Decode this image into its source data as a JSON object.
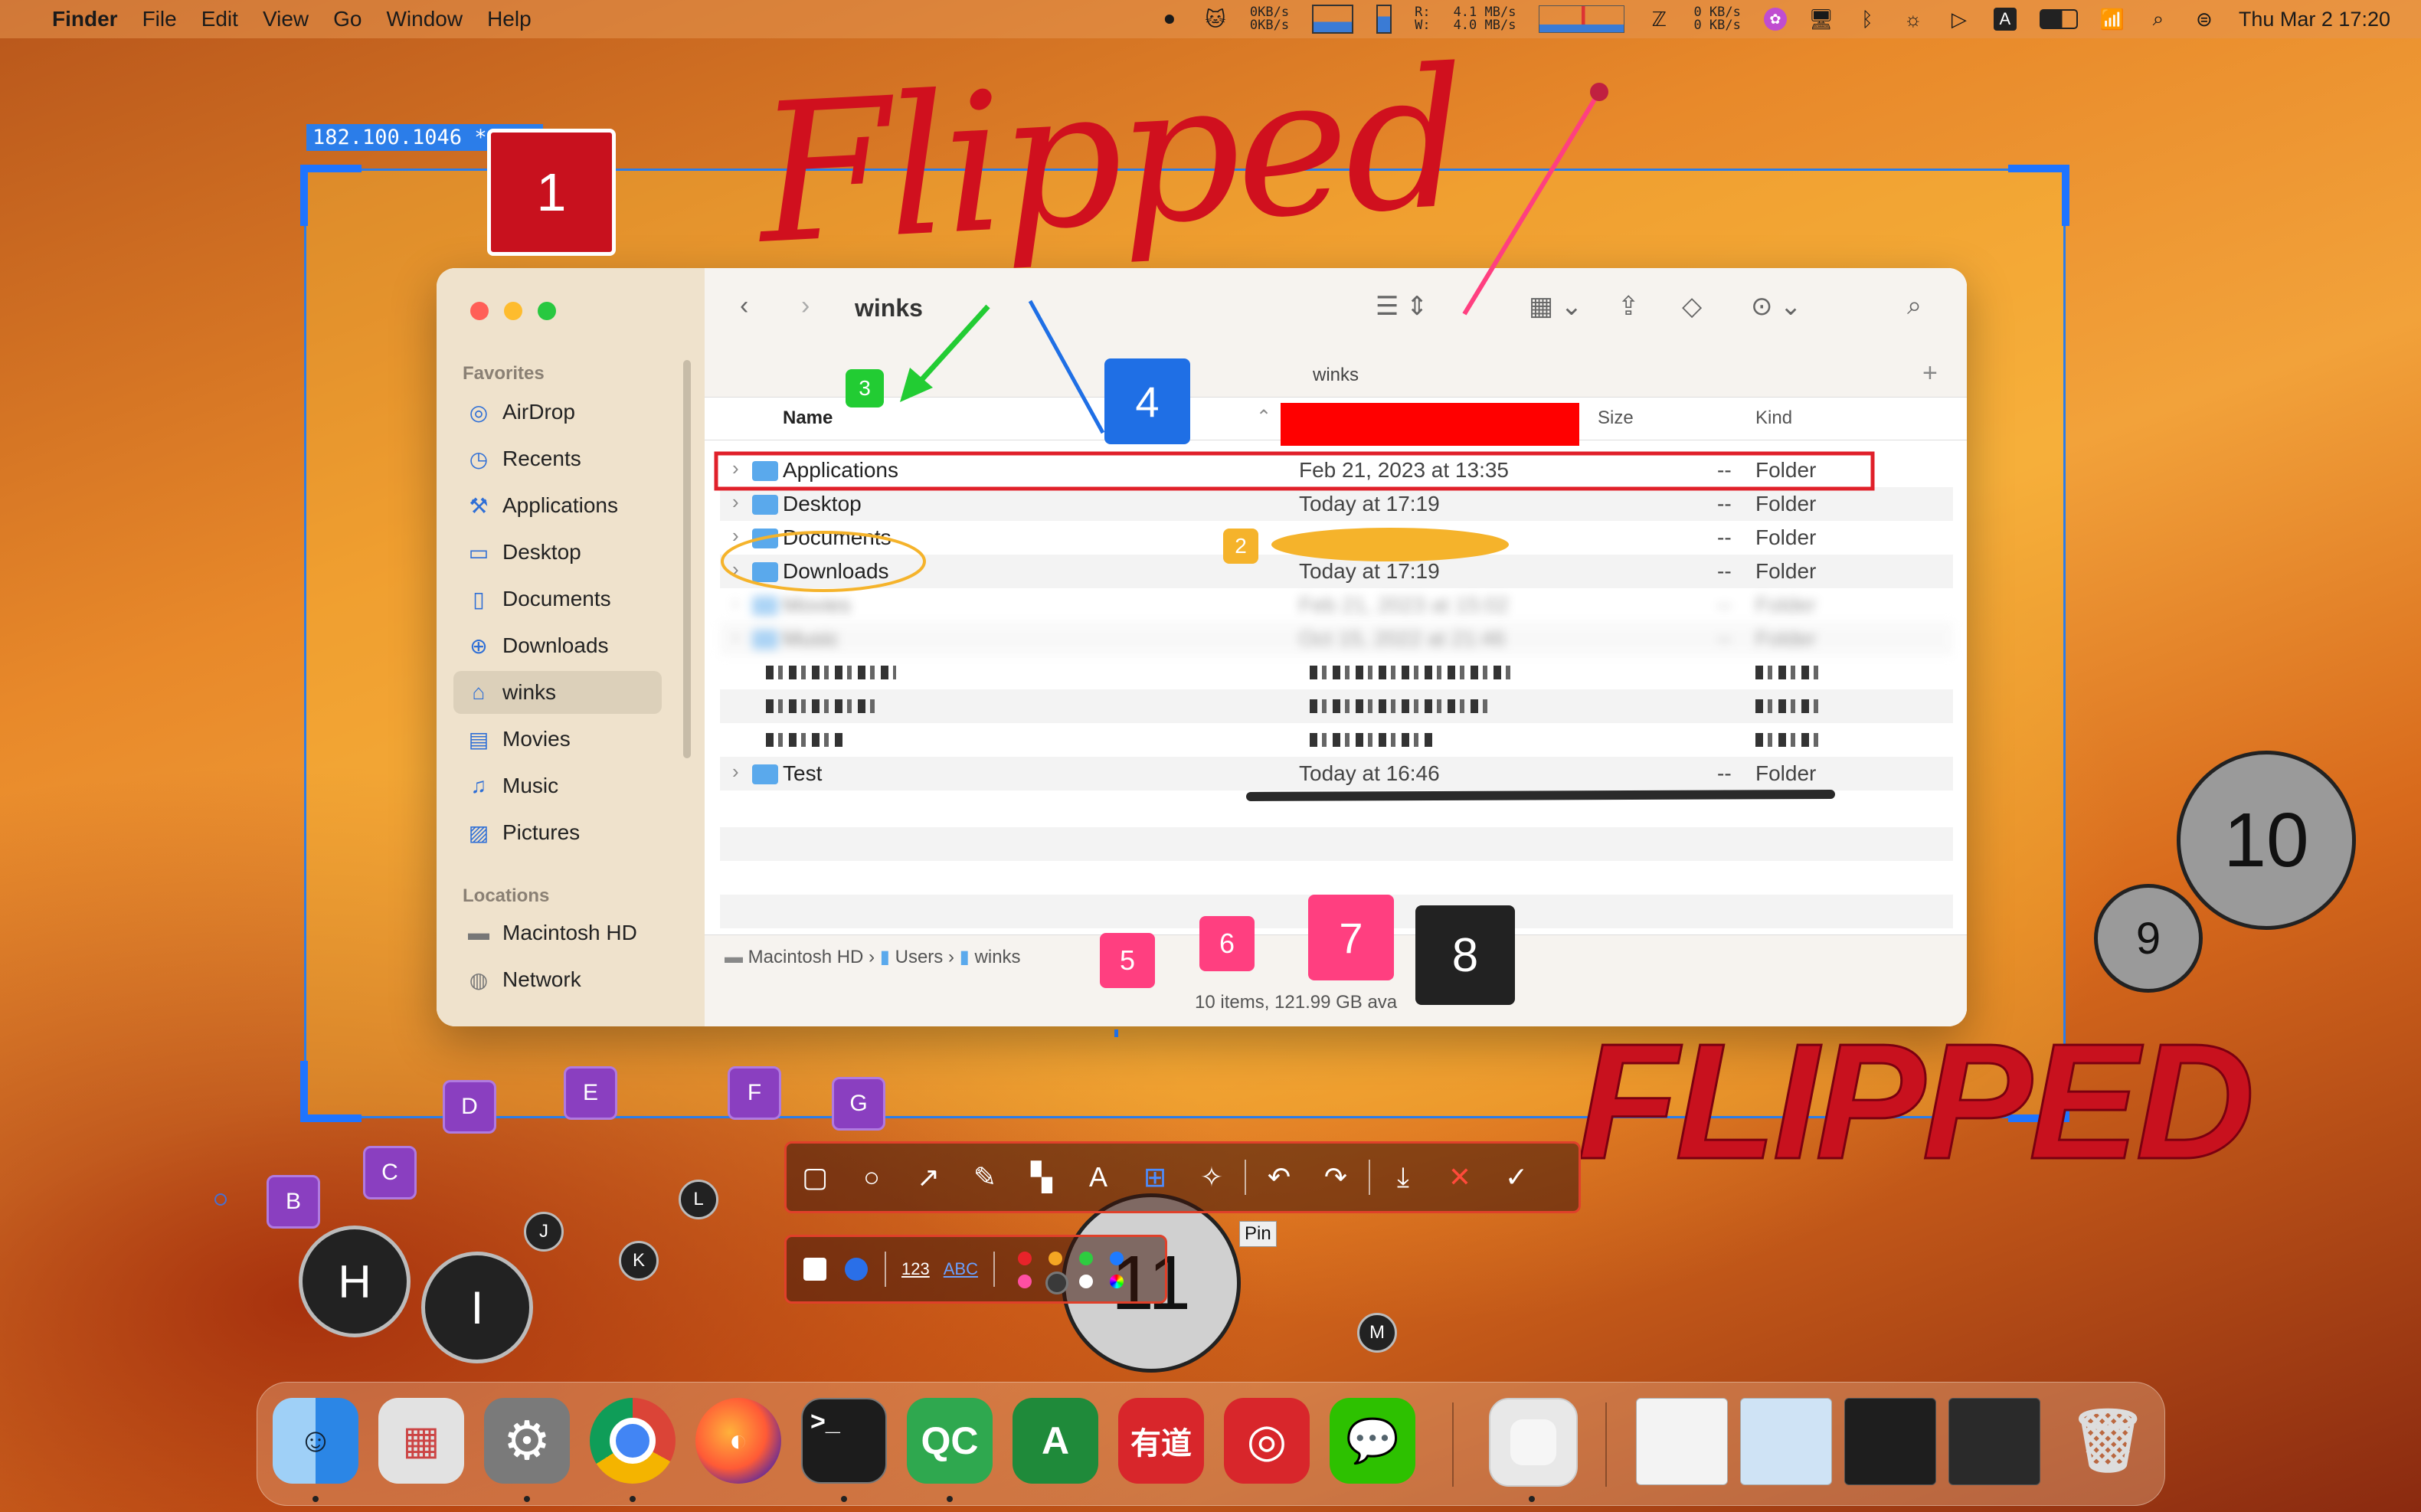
{
  "menubar": {
    "apple": "",
    "app": "Finder",
    "menus": [
      "File",
      "Edit",
      "View",
      "Go",
      "Window",
      "Help"
    ],
    "net1_up": "0KB/s",
    "net1_down": "0KB/s",
    "net2_up": "4.1 MB/s",
    "net2_down": "4.0 MB/s",
    "net2_r": "R:",
    "net2_w": "W:",
    "net3_up": "0 KB/s",
    "net3_down": "0 KB/s",
    "input_source": "A",
    "datetime": "Thu Mar 2  17:20"
  },
  "selection": {
    "size_label": "182.100.1046 * 565",
    "frame_color": "#2b7de9"
  },
  "annotations": {
    "handwriting": "Flipped",
    "wordart": "FLIPPED",
    "numbers": [
      "1",
      "2",
      "3",
      "4",
      "5",
      "6",
      "7",
      "8",
      "9",
      "10",
      "11"
    ],
    "letters": [
      "B",
      "C",
      "D",
      "E",
      "F",
      "G",
      "H",
      "I",
      "J",
      "K",
      "L",
      "M"
    ],
    "tooltip": "Pin"
  },
  "finder": {
    "title": "winks",
    "path_title": "winks",
    "sidebar": {
      "favorites_heading": "Favorites",
      "items": [
        {
          "label": "AirDrop",
          "icon": "airdrop-icon"
        },
        {
          "label": "Recents",
          "icon": "clock-icon"
        },
        {
          "label": "Applications",
          "icon": "applications-icon"
        },
        {
          "label": "Desktop",
          "icon": "desktop-icon"
        },
        {
          "label": "Documents",
          "icon": "document-icon"
        },
        {
          "label": "Downloads",
          "icon": "download-icon"
        },
        {
          "label": "winks",
          "icon": "home-icon"
        },
        {
          "label": "Movies",
          "icon": "film-icon"
        },
        {
          "label": "Music",
          "icon": "music-note-icon"
        },
        {
          "label": "Pictures",
          "icon": "photo-icon"
        }
      ],
      "locations_heading": "Locations",
      "locations": [
        {
          "label": "Macintosh HD",
          "icon": "disk-icon"
        },
        {
          "label": "Network",
          "icon": "globe-icon"
        }
      ]
    },
    "columns": {
      "name": "Name",
      "size": "Size",
      "kind": "Kind"
    },
    "rows": [
      {
        "name": "Applications",
        "date": "Feb 21, 2023 at 13:35",
        "size": "--",
        "kind": "Folder"
      },
      {
        "name": "Desktop",
        "date": "Today at 17:19",
        "size": "--",
        "kind": "Folder"
      },
      {
        "name": "Documents",
        "date": "",
        "size": "--",
        "kind": "Folder"
      },
      {
        "name": "Downloads",
        "date": "Today at 17:19",
        "size": "--",
        "kind": "Folder"
      },
      {
        "name": "Movies",
        "date": "Feb 21, 2023 at 15:02",
        "size": "--",
        "kind": "Folder"
      },
      {
        "name": "Music",
        "date": "Oct 15, 2022 at 21:46",
        "size": "--",
        "kind": "Folder"
      },
      {
        "name": "Test",
        "date": "Today at 16:46",
        "size": "--",
        "kind": "Folder"
      }
    ],
    "breadcrumb": [
      "Macintosh HD",
      "Users",
      "winks"
    ],
    "status": "10 items, 121.99 GB ava"
  },
  "screenshot_tools": {
    "toolbar": [
      "rectangle-icon",
      "ellipse-icon",
      "arrow-icon",
      "pencil-icon",
      "mosaic-icon",
      "text-icon",
      "callout-icon",
      "pin-icon",
      "undo-icon",
      "redo-icon",
      "download-icon",
      "close-icon",
      "check-icon"
    ],
    "options": {
      "counter": "123",
      "letters": "ABC"
    },
    "palette": [
      "#e8232a",
      "#f5a623",
      "#2ecc40",
      "#1e7bff",
      "#ff4fa3",
      "#3a3a3a",
      "#ffffff",
      "#b84dff"
    ]
  },
  "dock": {
    "apps": [
      {
        "label": "",
        "icon": "finder-icon",
        "color": "#3a9cf0"
      },
      {
        "label": "",
        "icon": "launchpad-icon",
        "color": "#d8d8d8"
      },
      {
        "label": "",
        "icon": "settings-gear-icon",
        "color": "#7a7a7a"
      },
      {
        "label": "",
        "icon": "chrome-icon",
        "color": "#ffffff"
      },
      {
        "label": "",
        "icon": "firefox-icon",
        "color": "#5b2a9e"
      },
      {
        "label": ">_",
        "icon": "terminal-icon",
        "color": "#1c1c1c"
      },
      {
        "label": "QC",
        "icon": "qc-icon",
        "color": "#2fa84f"
      },
      {
        "label": "A",
        "icon": "a-app-icon",
        "color": "#1f8a3a"
      },
      {
        "label": "有道",
        "icon": "youdao-icon",
        "color": "#d8262b"
      },
      {
        "label": "",
        "icon": "netease-music-icon",
        "color": "#d8262b"
      },
      {
        "label": "",
        "icon": "wechat-icon",
        "color": "#2dc100"
      },
      {
        "label": "",
        "icon": "app-placeholder-icon",
        "color": "#e8e8e8"
      }
    ]
  }
}
